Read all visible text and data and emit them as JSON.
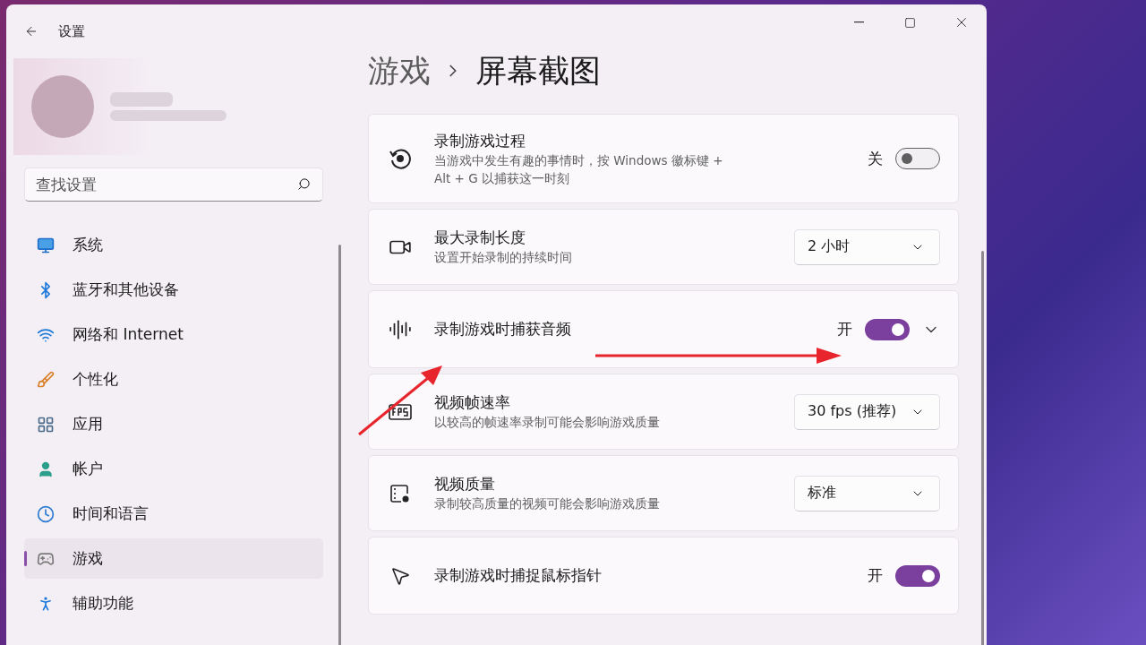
{
  "window": {
    "title": "设置"
  },
  "search": {
    "placeholder": "查找设置"
  },
  "nav": [
    {
      "label": "系统",
      "selected": false
    },
    {
      "label": "蓝牙和其他设备",
      "selected": false
    },
    {
      "label": "网络和 Internet",
      "selected": false
    },
    {
      "label": "个性化",
      "selected": false
    },
    {
      "label": "应用",
      "selected": false
    },
    {
      "label": "帐户",
      "selected": false
    },
    {
      "label": "时间和语言",
      "selected": false
    },
    {
      "label": "游戏",
      "selected": true
    },
    {
      "label": "辅助功能",
      "selected": false
    }
  ],
  "breadcrumb": [
    "游戏",
    "屏幕截图"
  ],
  "settings": [
    {
      "title": "录制游戏过程",
      "description": "当游戏中发生有趣的事情时，按 Windows 徽标键 + Alt + G 以捕获这一时刻",
      "kind": "toggle",
      "on": false,
      "state_label": "关"
    },
    {
      "title": "最大录制长度",
      "description": "设置开始录制的持续时间",
      "kind": "dropdown",
      "value": "2 小时"
    },
    {
      "title": "录制游戏时捕获音频",
      "kind": "toggle",
      "on": true,
      "state_label": "开",
      "expanded": false
    },
    {
      "title": "视频帧速率",
      "description": "以较高的帧速率录制可能会影响游戏质量",
      "kind": "dropdown",
      "value": "30 fps (推荐)"
    },
    {
      "title": "视频质量",
      "description": "录制较高质量的视频可能会影响游戏质量",
      "kind": "dropdown",
      "value": "标准"
    },
    {
      "title": "录制游戏时捕捉鼠标指针",
      "kind": "toggle",
      "on": true,
      "state_label": "开"
    }
  ]
}
